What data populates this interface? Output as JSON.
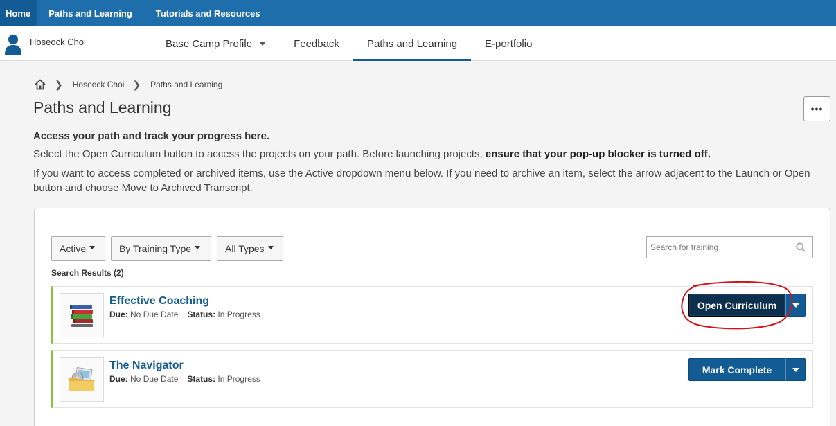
{
  "topnav": {
    "tabs": [
      {
        "label": "Home"
      },
      {
        "label": "Paths and Learning"
      },
      {
        "label": "Tutorials and Resources"
      }
    ]
  },
  "profile": {
    "user_name": "Hoseock Choi",
    "subnav": [
      {
        "label": "Base Camp Profile",
        "has_dropdown": true
      },
      {
        "label": "Feedback"
      },
      {
        "label": "Paths and Learning",
        "active": true
      },
      {
        "label": "E-portfolio"
      }
    ]
  },
  "breadcrumb": {
    "items": [
      "Hoseock Choi",
      "Paths and Learning"
    ]
  },
  "page": {
    "title": "Paths and Learning",
    "more_label": "•••",
    "intro_heading": "Access your path and track your progress here.",
    "intro_line1": "Select the Open Curriculum button to access the projects on your path. Before launching projects,",
    "intro_line1_bold": "ensure that your pop-up blocker is turned off.",
    "intro_line2": "If you want to access completed or archived items, use the Active dropdown menu below. If you need to archive an item, select the arrow adjacent to the Launch or Open button and choose Move to Archived Transcript."
  },
  "filters": {
    "status": "Active",
    "group_by": "By Training Type",
    "types": "All Types",
    "search_placeholder": "Search for training"
  },
  "results": {
    "label": "Search Results (2)",
    "due_label": "Due:",
    "status_label": "Status:",
    "items": [
      {
        "title": "Effective Coaching",
        "due": "No Due Date",
        "status": "In Progress",
        "action": "Open Curriculum",
        "icon": "books-icon"
      },
      {
        "title": "The Navigator",
        "due": "No Due Date",
        "status": "In Progress",
        "action": "Mark Complete",
        "icon": "folder-icon"
      }
    ]
  },
  "colors": {
    "topbar": "#1e6eab",
    "primary_button": "#125b94",
    "title_link": "#125b94",
    "row_accent": "#8fbf3f",
    "annotation": "#d0121b"
  }
}
